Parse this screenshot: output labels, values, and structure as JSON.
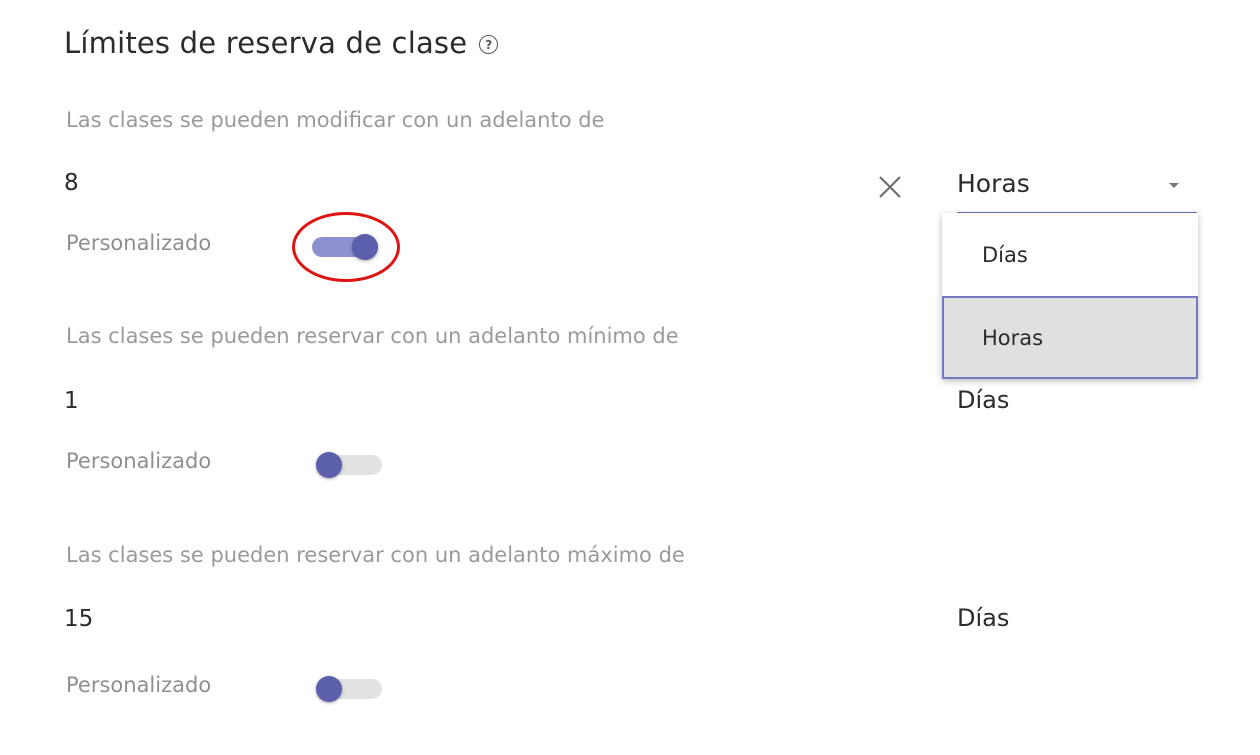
{
  "header": {
    "title": "Límites de reserva de clase",
    "help_icon": "help-circle-icon"
  },
  "sections": [
    {
      "caption": "Las clases se pueden modificar con un adelanto de",
      "value": "8",
      "unit": "Horas",
      "custom_label": "Personalizado",
      "custom_enabled": true
    },
    {
      "caption": "Las clases se pueden reservar con un adelanto mínimo de",
      "value": "1",
      "unit": "Días",
      "custom_label": "Personalizado",
      "custom_enabled": false
    },
    {
      "caption": "Las clases se pueden reservar con un adelanto máximo de",
      "value": "15",
      "unit": "Días",
      "custom_label": "Personalizado",
      "custom_enabled": false
    }
  ],
  "unit_dropdown": {
    "open": true,
    "options": [
      "Días",
      "Horas"
    ],
    "highlighted": "Horas"
  },
  "colors": {
    "accent": "#5b5fac",
    "highlight_ring": "#e01313"
  }
}
